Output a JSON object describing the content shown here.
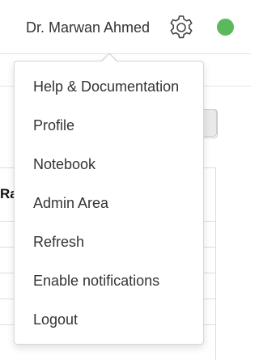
{
  "header": {
    "user_name": "Dr. Marwan Ahmed",
    "settings_icon": "gear-icon",
    "status_color": "#5cb85c"
  },
  "background": {
    "table_header_fragment": "Ra"
  },
  "menu": {
    "items": [
      {
        "label": "Help & Documentation"
      },
      {
        "label": "Profile"
      },
      {
        "label": "Notebook"
      },
      {
        "label": "Admin Area"
      },
      {
        "label": "Refresh"
      },
      {
        "label": "Enable notifications"
      },
      {
        "label": "Logout"
      }
    ]
  }
}
